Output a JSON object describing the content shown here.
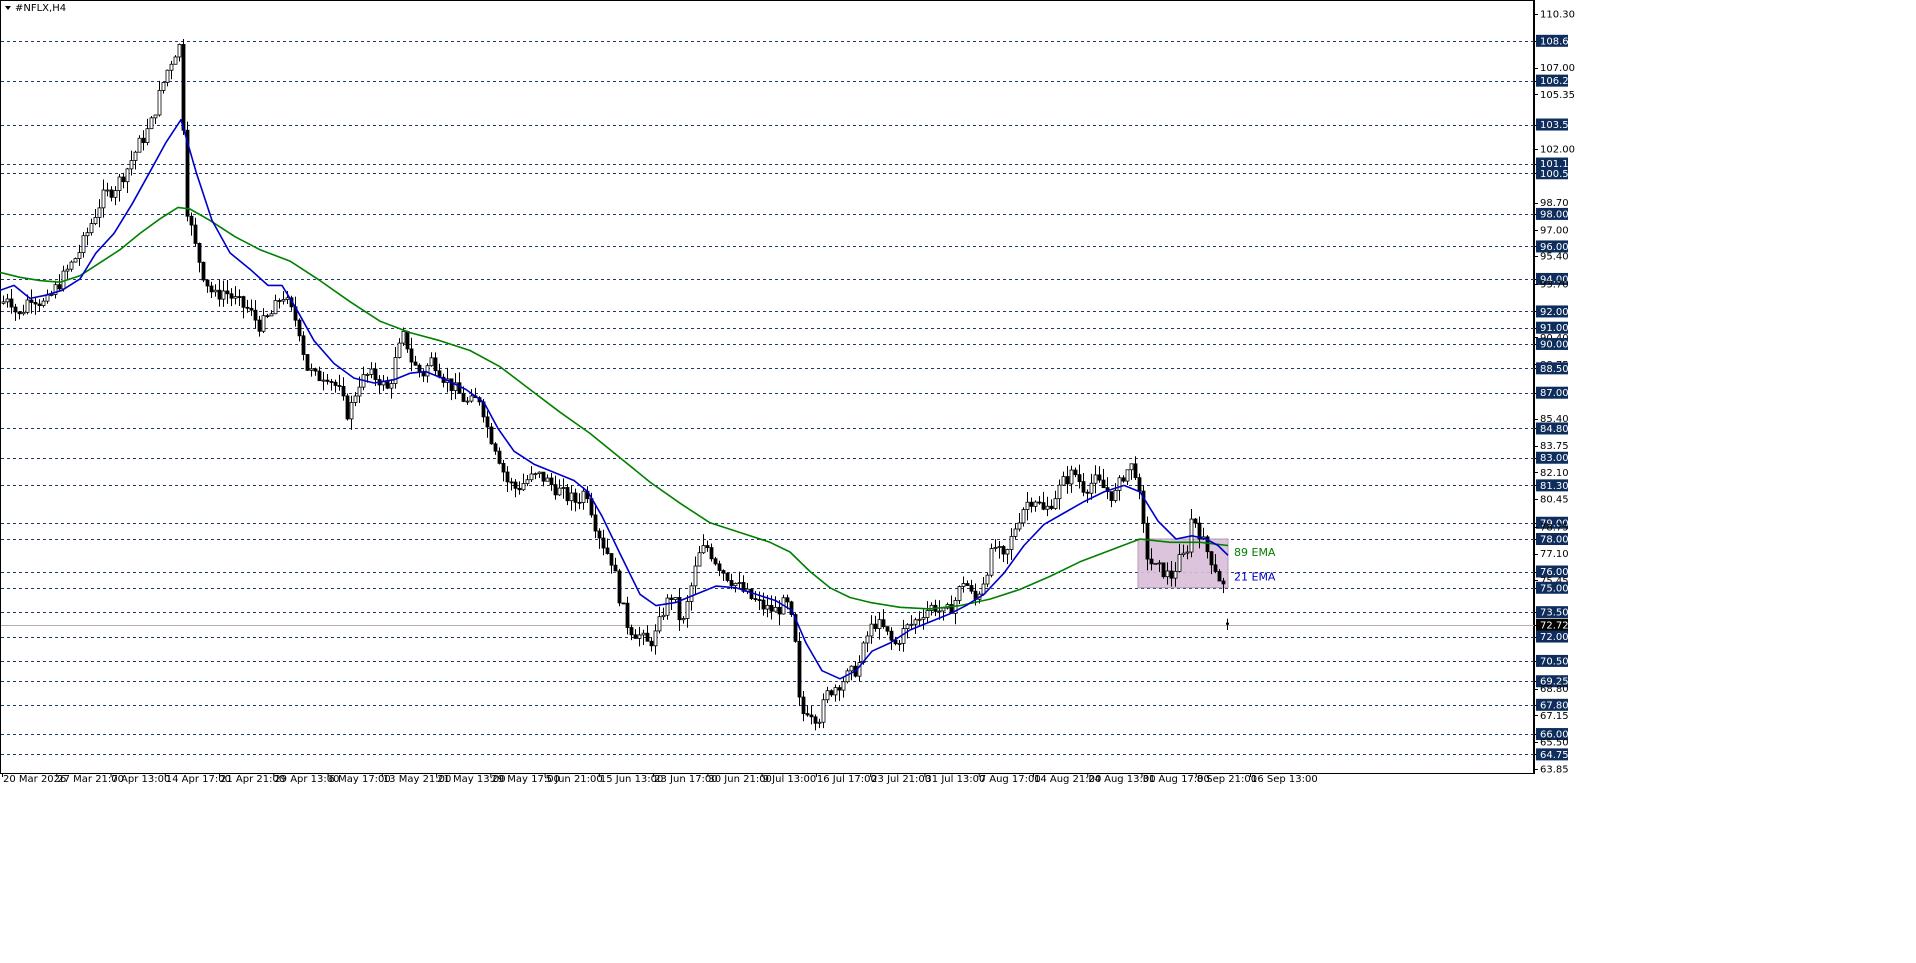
{
  "window": {
    "symbol_title": "#NFLX,H4",
    "menu_icon": "triangle-down-icon"
  },
  "colors": {
    "background": "#ffffff",
    "grid_dashed": "#1f3a6b",
    "candle": "#000000",
    "ema21": "#0000cc",
    "ema89": "#008000",
    "zone_fill": "#d8bfd8",
    "zone_stroke": "#b79ab7",
    "level_badge_bg": "#0f2d5c",
    "current_price_badge_bg": "#000000",
    "current_price_line": "#b0b0b0"
  },
  "chart_data": {
    "type": "candlestick",
    "title": "#NFLX,H4",
    "ylim": [
      63.85,
      110.3
    ],
    "y_ticks": [
      "110.30",
      "108.65",
      "107.00",
      "106.20",
      "105.35",
      "103.50",
      "102.00",
      "101.10",
      "100.50",
      "98.70",
      "98.00",
      "97.00",
      "96.00",
      "95.40",
      "94.00",
      "93.70",
      "92.00",
      "91.00",
      "90.40",
      "90.00",
      "88.75",
      "88.50",
      "87.00",
      "85.40",
      "84.80",
      "83.75",
      "83.00",
      "82.10",
      "81.30",
      "80.45",
      "79.00",
      "78.75",
      "78.00",
      "77.10",
      "76.00",
      "75.45",
      "75.00",
      "73.50",
      "72.72",
      "72.00",
      "70.50",
      "69.25",
      "68.80",
      "67.80",
      "67.15",
      "66.00",
      "65.50",
      "64.75",
      "63.85"
    ],
    "highlighted_levels": [
      "108.65",
      "106.20",
      "103.50",
      "101.10",
      "100.50",
      "98.00",
      "96.00",
      "94.00",
      "92.00",
      "91.00",
      "90.00",
      "88.50",
      "87.00",
      "84.80",
      "83.00",
      "81.30",
      "79.00",
      "78.00",
      "76.00",
      "75.00",
      "73.50",
      "72.00",
      "70.50",
      "69.25",
      "67.80",
      "66.00",
      "64.75"
    ],
    "current_price": "72.72",
    "x_labels": [
      "20 Mar 2026",
      "27 Mar 21:00",
      "7 Apr 13:00",
      "14 Apr 17:00",
      "21 Apr 21:00",
      "29 Apr 13:00",
      "6 May 17:00",
      "13 May 21:00",
      "21 May 13:00",
      "29 May 17:00",
      "5 Jun 21:00",
      "15 Jun 13:00",
      "23 Jun 17:00",
      "30 Jun 21:00",
      "9 Jul 13:00",
      "16 Jul 17:00",
      "23 Jul 21:00",
      "31 Jul 13:00",
      "7 Aug 17:00",
      "14 Aug 21:00",
      "24 Aug 13:00",
      "31 Aug 17:00",
      "8 Sep 21:00",
      "16 Sep 13:00"
    ],
    "price_path": [
      [
        0,
        92.3
      ],
      [
        8,
        93.1
      ],
      [
        18,
        91.6
      ],
      [
        30,
        93.0
      ],
      [
        45,
        92.4
      ],
      [
        55,
        93.4
      ],
      [
        68,
        94.6
      ],
      [
        80,
        95.8
      ],
      [
        92,
        97.6
      ],
      [
        102,
        99.0
      ],
      [
        114,
        99.6
      ],
      [
        126,
        100.7
      ],
      [
        138,
        102.2
      ],
      [
        150,
        103.4
      ],
      [
        158,
        105.1
      ],
      [
        166,
        106.7
      ],
      [
        174,
        107.9
      ],
      [
        180,
        108.4
      ],
      [
        186,
        98.6
      ],
      [
        194,
        96.2
      ],
      [
        204,
        94.1
      ],
      [
        214,
        92.9
      ],
      [
        224,
        93.3
      ],
      [
        236,
        92.6
      ],
      [
        248,
        92.1
      ],
      [
        260,
        91.1
      ],
      [
        272,
        91.9
      ],
      [
        282,
        93.1
      ],
      [
        290,
        92.1
      ],
      [
        298,
        91.2
      ],
      [
        306,
        88.6
      ],
      [
        316,
        87.9
      ],
      [
        326,
        88.2
      ],
      [
        338,
        87.2
      ],
      [
        348,
        85.6
      ],
      [
        358,
        87.6
      ],
      [
        368,
        88.1
      ],
      [
        378,
        87.9
      ],
      [
        388,
        87.1
      ],
      [
        396,
        89.2
      ],
      [
        404,
        90.6
      ],
      [
        412,
        88.8
      ],
      [
        422,
        88.1
      ],
      [
        432,
        89.1
      ],
      [
        444,
        87.9
      ],
      [
        456,
        87.1
      ],
      [
        468,
        86.3
      ],
      [
        480,
        86.7
      ],
      [
        488,
        84.6
      ],
      [
        496,
        83.6
      ],
      [
        506,
        81.6
      ],
      [
        516,
        81.1
      ],
      [
        528,
        81.7
      ],
      [
        540,
        81.9
      ],
      [
        552,
        81.3
      ],
      [
        564,
        80.7
      ],
      [
        576,
        80.3
      ],
      [
        586,
        81.1
      ],
      [
        594,
        79.1
      ],
      [
        602,
        77.8
      ],
      [
        612,
        76.6
      ],
      [
        620,
        74.2
      ],
      [
        628,
        72.6
      ],
      [
        638,
        72.1
      ],
      [
        648,
        71.5
      ],
      [
        656,
        72.2
      ],
      [
        664,
        73.8
      ],
      [
        672,
        74.6
      ],
      [
        682,
        72.6
      ],
      [
        690,
        74.8
      ],
      [
        698,
        76.9
      ],
      [
        706,
        77.6
      ],
      [
        716,
        76.6
      ],
      [
        726,
        75.8
      ],
      [
        736,
        75.2
      ],
      [
        746,
        74.6
      ],
      [
        756,
        74.1
      ],
      [
        766,
        73.7
      ],
      [
        776,
        73.6
      ],
      [
        786,
        74.1
      ],
      [
        794,
        72.3
      ],
      [
        800,
        67.1
      ],
      [
        808,
        67.6
      ],
      [
        818,
        66.9
      ],
      [
        828,
        68.6
      ],
      [
        838,
        69.1
      ],
      [
        848,
        69.6
      ],
      [
        858,
        70.1
      ],
      [
        866,
        71.9
      ],
      [
        874,
        72.9
      ],
      [
        884,
        72.4
      ],
      [
        894,
        71.4
      ],
      [
        904,
        72.4
      ],
      [
        914,
        72.9
      ],
      [
        924,
        73.6
      ],
      [
        934,
        73.9
      ],
      [
        944,
        73.3
      ],
      [
        954,
        74.1
      ],
      [
        964,
        75.6
      ],
      [
        974,
        74.1
      ],
      [
        984,
        75.6
      ],
      [
        994,
        77.6
      ],
      [
        1004,
        76.6
      ],
      [
        1014,
        78.6
      ],
      [
        1024,
        80.1
      ],
      [
        1034,
        80.6
      ],
      [
        1044,
        79.6
      ],
      [
        1054,
        80.6
      ],
      [
        1064,
        81.6
      ],
      [
        1074,
        82.1
      ],
      [
        1084,
        81.1
      ],
      [
        1094,
        81.6
      ],
      [
        1104,
        81.1
      ],
      [
        1114,
        80.6
      ],
      [
        1124,
        82.1
      ],
      [
        1134,
        82.6
      ],
      [
        1140,
        80.1
      ],
      [
        1146,
        77.1
      ],
      [
        1154,
        76.2
      ],
      [
        1162,
        76.1
      ],
      [
        1170,
        75.6
      ],
      [
        1178,
        76.6
      ],
      [
        1186,
        77.1
      ],
      [
        1192,
        79.6
      ],
      [
        1198,
        78.6
      ],
      [
        1204,
        77.6
      ],
      [
        1210,
        76.9
      ],
      [
        1216,
        76.1
      ],
      [
        1222,
        75.1
      ],
      [
        1226,
        75.0
      ]
    ],
    "ema21_path": [
      [
        0,
        93.3
      ],
      [
        14,
        93.6
      ],
      [
        30,
        92.8
      ],
      [
        46,
        93.0
      ],
      [
        62,
        93.3
      ],
      [
        80,
        94.0
      ],
      [
        96,
        95.6
      ],
      [
        114,
        96.8
      ],
      [
        132,
        98.6
      ],
      [
        150,
        100.6
      ],
      [
        166,
        102.4
      ],
      [
        181,
        103.8
      ],
      [
        196,
        100.6
      ],
      [
        212,
        97.6
      ],
      [
        230,
        95.6
      ],
      [
        250,
        94.6
      ],
      [
        268,
        93.6
      ],
      [
        282,
        93.6
      ],
      [
        296,
        92.2
      ],
      [
        314,
        90.2
      ],
      [
        334,
        88.8
      ],
      [
        354,
        87.9
      ],
      [
        374,
        87.6
      ],
      [
        394,
        87.8
      ],
      [
        410,
        88.2
      ],
      [
        426,
        88.3
      ],
      [
        446,
        87.8
      ],
      [
        466,
        87.2
      ],
      [
        484,
        86.4
      ],
      [
        498,
        84.8
      ],
      [
        514,
        83.4
      ],
      [
        534,
        82.6
      ],
      [
        554,
        82.1
      ],
      [
        574,
        81.6
      ],
      [
        588,
        80.9
      ],
      [
        602,
        79.4
      ],
      [
        620,
        77.1
      ],
      [
        640,
        74.6
      ],
      [
        656,
        73.9
      ],
      [
        676,
        74.1
      ],
      [
        696,
        74.6
      ],
      [
        716,
        75.1
      ],
      [
        736,
        75.0
      ],
      [
        756,
        74.6
      ],
      [
        776,
        74.2
      ],
      [
        792,
        73.6
      ],
      [
        806,
        71.6
      ],
      [
        822,
        69.9
      ],
      [
        840,
        69.4
      ],
      [
        856,
        69.9
      ],
      [
        872,
        71.1
      ],
      [
        890,
        71.6
      ],
      [
        910,
        72.4
      ],
      [
        930,
        72.9
      ],
      [
        950,
        73.4
      ],
      [
        966,
        73.9
      ],
      [
        984,
        74.6
      ],
      [
        1004,
        75.9
      ],
      [
        1024,
        77.6
      ],
      [
        1044,
        78.9
      ],
      [
        1064,
        79.6
      ],
      [
        1084,
        80.3
      ],
      [
        1104,
        80.9
      ],
      [
        1124,
        81.3
      ],
      [
        1140,
        80.9
      ],
      [
        1158,
        79.1
      ],
      [
        1176,
        78.0
      ],
      [
        1192,
        78.2
      ],
      [
        1206,
        78.0
      ],
      [
        1218,
        77.6
      ],
      [
        1228,
        77.0
      ]
    ],
    "ema89_path": [
      [
        0,
        94.4
      ],
      [
        20,
        94.1
      ],
      [
        40,
        93.9
      ],
      [
        60,
        93.8
      ],
      [
        80,
        94.2
      ],
      [
        100,
        95.0
      ],
      [
        120,
        95.8
      ],
      [
        140,
        96.8
      ],
      [
        160,
        97.7
      ],
      [
        178,
        98.4
      ],
      [
        190,
        98.3
      ],
      [
        210,
        97.6
      ],
      [
        235,
        96.6
      ],
      [
        260,
        95.8
      ],
      [
        290,
        95.1
      ],
      [
        320,
        93.9
      ],
      [
        350,
        92.6
      ],
      [
        380,
        91.4
      ],
      [
        410,
        90.7
      ],
      [
        440,
        90.2
      ],
      [
        470,
        89.6
      ],
      [
        500,
        88.6
      ],
      [
        530,
        87.2
      ],
      [
        560,
        85.8
      ],
      [
        590,
        84.5
      ],
      [
        620,
        83.0
      ],
      [
        650,
        81.5
      ],
      [
        680,
        80.2
      ],
      [
        710,
        79.0
      ],
      [
        740,
        78.4
      ],
      [
        770,
        77.8
      ],
      [
        790,
        77.2
      ],
      [
        810,
        76.0
      ],
      [
        830,
        75.0
      ],
      [
        850,
        74.4
      ],
      [
        870,
        74.1
      ],
      [
        900,
        73.8
      ],
      [
        930,
        73.7
      ],
      [
        960,
        73.9
      ],
      [
        990,
        74.3
      ],
      [
        1020,
        74.9
      ],
      [
        1050,
        75.7
      ],
      [
        1080,
        76.6
      ],
      [
        1110,
        77.3
      ],
      [
        1140,
        78.0
      ],
      [
        1170,
        77.8
      ],
      [
        1200,
        77.8
      ],
      [
        1228,
        77.6
      ]
    ],
    "zone": {
      "x0": 1138,
      "x1": 1228,
      "y_top": 78.0,
      "y_bottom": 75.0
    },
    "annotations": [
      {
        "text": "89 EMA",
        "series": "ema89"
      },
      {
        "text": "21 EMA",
        "series": "ema21"
      }
    ],
    "grid": "horizontal dashed at highlighted levels"
  }
}
